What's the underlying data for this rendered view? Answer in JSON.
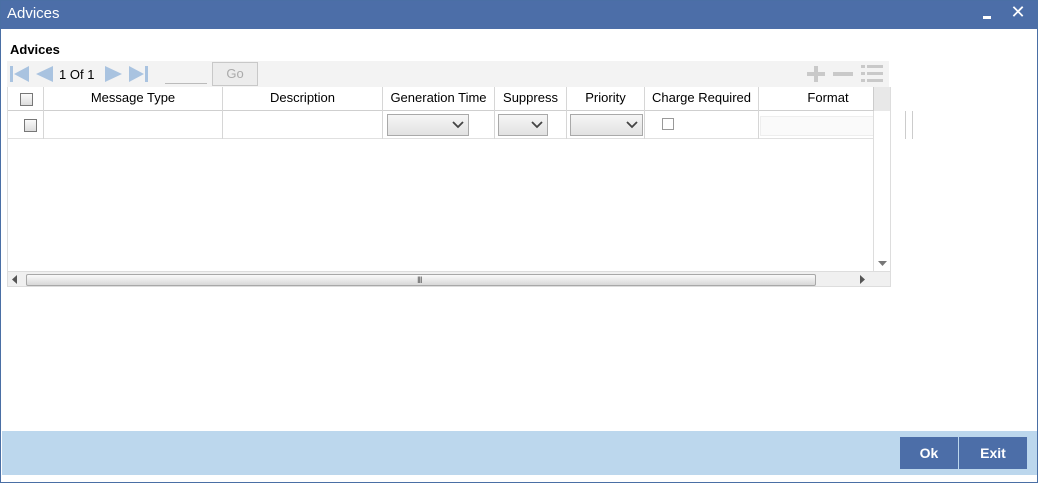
{
  "window": {
    "title": "Advices",
    "minimize_icon": "minimize-icon",
    "close_icon": "close-icon",
    "close_glyph": "✕",
    "title_bar_color": "#4c6ea8"
  },
  "section": {
    "title": "Advices"
  },
  "pager": {
    "current_page": "1",
    "of_label": "Of",
    "total_pages": "1",
    "page_input_value": "",
    "go_label": "Go",
    "icons": [
      "first-page-icon",
      "previous-page-icon",
      "next-page-icon",
      "last-page-icon"
    ]
  },
  "row_tools": {
    "icons": [
      "add-row-icon",
      "delete-row-icon",
      "single-view-icon"
    ]
  },
  "table": {
    "columns": [
      "Message Type",
      "Description",
      "Generation Time",
      "Suppress",
      "Priority",
      "Charge Required",
      "Format"
    ],
    "rows": [
      {
        "checked": false,
        "message_type": "",
        "description": "",
        "generation_time": "",
        "suppress": "",
        "priority": "",
        "charge_required": false,
        "format": ""
      }
    ],
    "scroll_grip": "III"
  },
  "footer": {
    "ok_label": "Ok",
    "exit_label": "Exit",
    "background_color": "#bcd7ed",
    "button_color": "#4c6ea8"
  }
}
